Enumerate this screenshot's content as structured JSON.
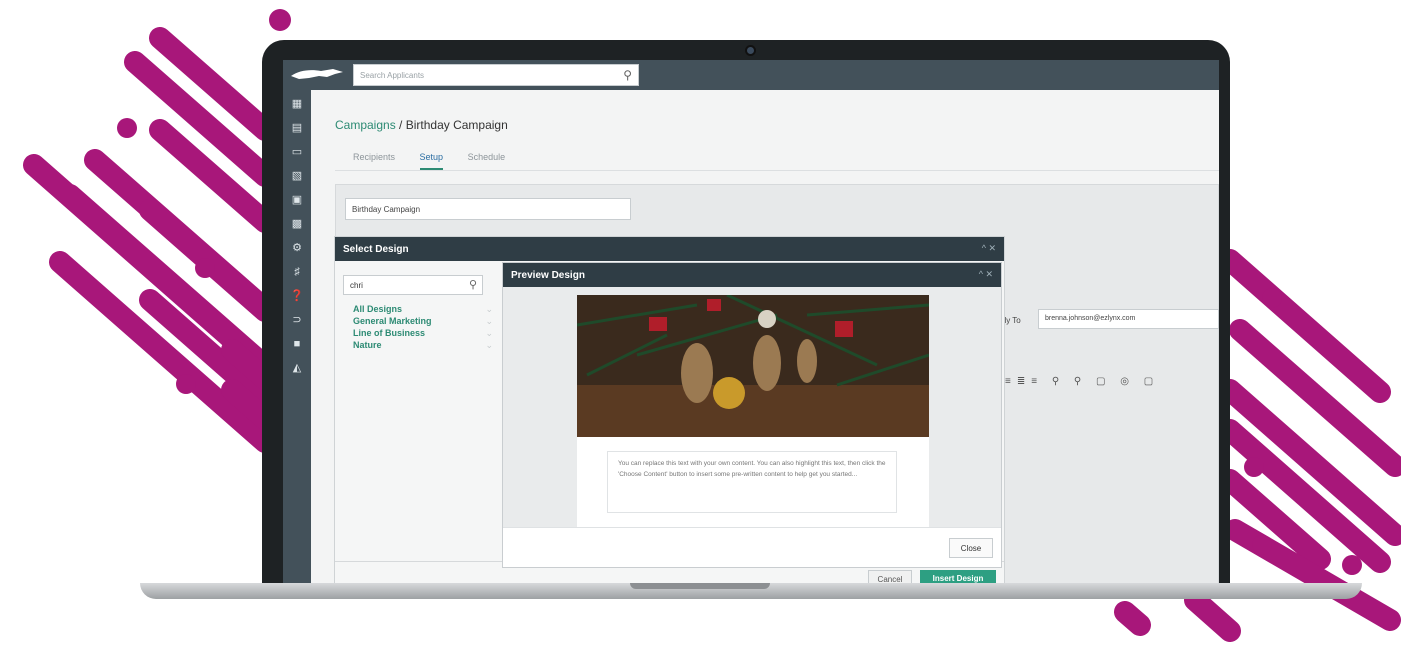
{
  "colors": {
    "accent": "#a8177a",
    "header": "#43515a",
    "link": "#2d8b74",
    "primary_button": "#2d9f82"
  },
  "search": {
    "placeholder": "Search Applicants"
  },
  "sidebar": {
    "icons": [
      "dashboard-icon",
      "contact-card-icon",
      "folder-icon",
      "org-chart-icon",
      "dollar-icon",
      "bar-chart-icon",
      "gear-icon",
      "key-icon",
      "help-icon",
      "magnet-icon",
      "briefcase-icon",
      "notifications-icon"
    ]
  },
  "breadcrumb": {
    "link": "Campaigns",
    "separator": " / ",
    "current": "Birthday Campaign"
  },
  "tabs": [
    "Recipients",
    "Setup",
    "Schedule"
  ],
  "campaign_name": "Birthday Campaign",
  "reply_to": {
    "label": "ply To",
    "value": "brenna.johnson@ezlynx.com"
  },
  "select_design": {
    "title": "Select Design",
    "search_value": "chri",
    "categories": [
      "All Designs",
      "General Marketing",
      "Line of Business",
      "Nature"
    ],
    "cancel_label": "Cancel",
    "insert_label": "Insert Design"
  },
  "preview": {
    "title": "Preview Design",
    "body_text": "You can replace this text with your own content. You can also highlight this text, then click the 'Choose Content' button to insert some pre-written content to help get you started...",
    "close_label": "Close"
  }
}
